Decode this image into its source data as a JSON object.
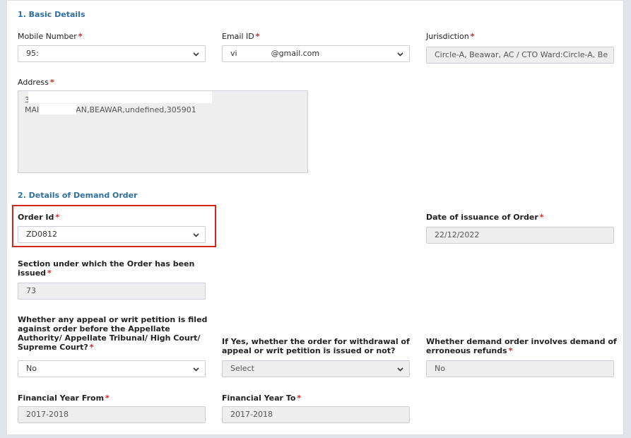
{
  "section1": {
    "title": "1. Basic Details"
  },
  "mobile": {
    "label": "Mobile Number",
    "value": "95:"
  },
  "email": {
    "label": "Email ID",
    "value_prefix": "vi",
    "value_suffix": "@gmail.com"
  },
  "jurisdiction": {
    "label": "Jurisdiction",
    "value": "Circle-A, Beawar, AC / CTO Ward:Circle-A, Be"
  },
  "address": {
    "label": "Address",
    "line1": "3",
    "line2_prefix": "MAI",
    "line2_suffix": "AN,BEAWAR,undefined,305901"
  },
  "section2": {
    "title": "2. Details of Demand Order"
  },
  "order_id": {
    "label": "Order Id",
    "value": "ZD0812"
  },
  "date_issuance": {
    "label": "Date of issuance of Order",
    "value": "22/12/2022"
  },
  "section_under": {
    "label_line1": "Section under which the Order has been",
    "label_line2": "issued",
    "value": "73"
  },
  "appeal": {
    "label_line1": "Whether any appeal or writ petition is filed",
    "label_line2": "against order before the Appellate",
    "label_line3": "Authority/ Appellate Tribunal/ High Court/",
    "label_line4": "Supreme Court?",
    "value": "No"
  },
  "withdrawal": {
    "label_line1": "If Yes, whether the order for withdrawal of",
    "label_line2": "appeal or writ petition is issued or not?",
    "value": "Select"
  },
  "erroneous": {
    "label_line1": "Whether demand order involves demand of",
    "label_line2": "erroneous refunds",
    "value": "No"
  },
  "fy_from": {
    "label": "Financial Year From",
    "value": "2017-2018"
  },
  "fy_to": {
    "label": "Financial Year To",
    "value": "2017-2018"
  },
  "colors": {
    "accent": "#2f6f9f",
    "required": "#d9241c",
    "highlight": "#d9241c"
  }
}
